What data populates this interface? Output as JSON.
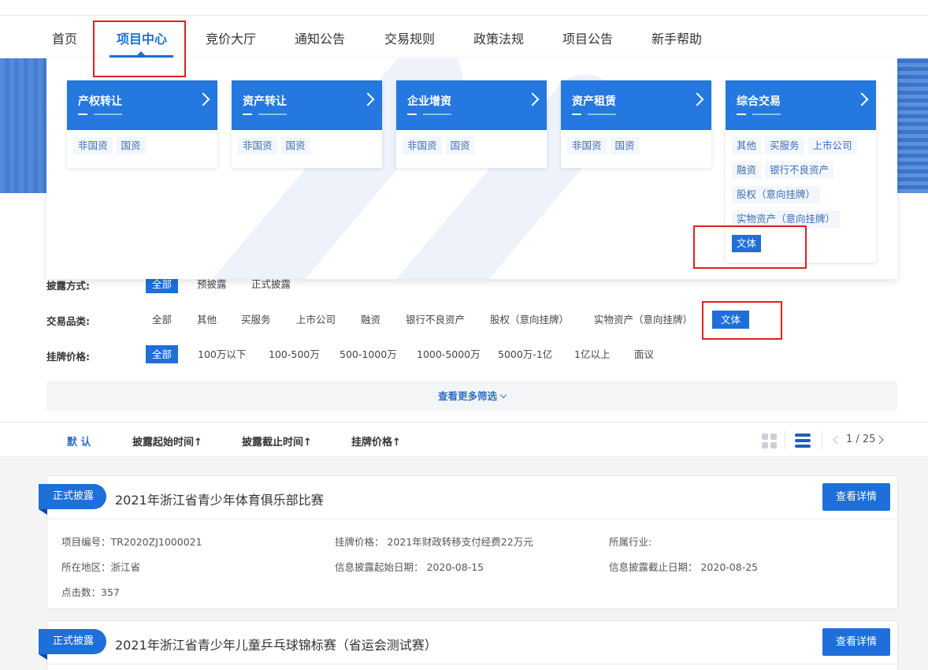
{
  "nav": {
    "items": [
      "首页",
      "项目中心",
      "竞价大厅",
      "通知公告",
      "交易规则",
      "政策法规",
      "项目公告",
      "新手帮助"
    ],
    "active": "项目中心"
  },
  "dropdown": {
    "cards": [
      {
        "title": "产权转让",
        "tags": [
          "非国资",
          "国资"
        ]
      },
      {
        "title": "资产转让",
        "tags": [
          "非国资",
          "国资"
        ]
      },
      {
        "title": "企业增资",
        "tags": [
          "非国资",
          "国资"
        ]
      },
      {
        "title": "资产租赁",
        "tags": [
          "非国资",
          "国资"
        ]
      },
      {
        "title": "综合交易",
        "tags": [
          "其他",
          "买服务",
          "上市公司",
          "融资",
          "银行不良资产",
          "股权（意向挂牌）",
          "实物资产（意向挂牌）",
          "文体"
        ],
        "active_tag": "文体"
      }
    ]
  },
  "filters": {
    "disclosure": {
      "label": "披露方式:",
      "options": [
        "全部",
        "预披露",
        "正式披露"
      ],
      "active": "全部"
    },
    "category": {
      "label": "交易品类:",
      "options": [
        "全部",
        "其他",
        "买服务",
        "上市公司",
        "融资",
        "银行不良资产",
        "股权（意向挂牌）",
        "实物资产（意向挂牌）",
        "文体"
      ],
      "active": "文体"
    },
    "price": {
      "label": "挂牌价格:",
      "options": [
        "全部",
        "100万以下",
        "100-500万",
        "500-1000万",
        "1000-5000万",
        "5000万-1亿",
        "1亿以上",
        "面议"
      ],
      "active": "全部"
    },
    "more_label": "查看更多筛选"
  },
  "sort": {
    "items": [
      "默 认",
      "披露起始时间",
      "披露截止时间",
      "挂牌价格"
    ],
    "arrow": "↑",
    "active": "默 认",
    "pagination": "1 / 25"
  },
  "listings": [
    {
      "badge": "正式披露",
      "title": "2021年浙江省青少年体育俱乐部比赛",
      "button": "查看详情",
      "fields": {
        "code": "项目编号：TR2020ZJ1000021",
        "price": "挂牌价格：  2021年财政转移支付经费22万元",
        "industry": "所属行业:",
        "region": "所在地区：浙江省",
        "start": "信息披露起始日期：  2020-08-15",
        "end": "信息披露截止日期：  2020-08-25",
        "clicks": "点击数：357"
      }
    },
    {
      "badge": "正式披露",
      "title": "2021年浙江省青少年儿童乒乓球锦标赛（省运会测试赛）",
      "button": "查看详情"
    }
  ],
  "icons": [
    "grid-view-icon",
    "list-view-icon",
    "chevron-left-icon",
    "chevron-right-icon",
    "chevron-down-icon",
    "card-arrow-icon"
  ],
  "colors": {
    "primary": "#1e6fd9",
    "highlight": "#e02020"
  }
}
